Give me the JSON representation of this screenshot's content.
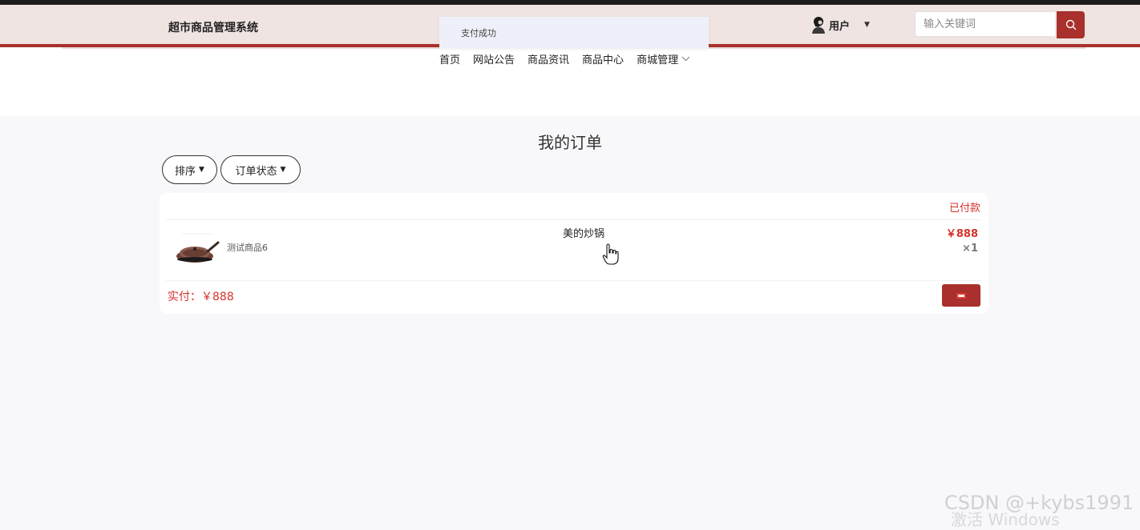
{
  "header": {
    "brand": "超市商品管理系统",
    "user_label": "用户",
    "search": {
      "placeholder": "输入关键词"
    }
  },
  "toast": {
    "message": "支付成功"
  },
  "nav": {
    "items": [
      "首页",
      "网站公告",
      "商品资讯",
      "商品中心"
    ],
    "dropdown_label": "商城管理"
  },
  "page": {
    "title": "我的订单"
  },
  "filters": {
    "sort": "排序",
    "status": "订单状态"
  },
  "order": {
    "status": "已付款",
    "product_name": "测试商品6",
    "product_title": "美的炒锅",
    "price": "￥888",
    "quantity": "×1",
    "paid_label": "实付：",
    "paid_amount": "￥888"
  },
  "watermark": {
    "csdn": "CSDN @+kybs1991",
    "windows": "激活 Windows"
  },
  "colors": {
    "accent": "#a9302c",
    "status_red": "#d6322d",
    "header_bg": "#efe4e2"
  },
  "icons": {
    "avatar": "avatar-icon",
    "search": "search-icon",
    "caret": "caret-down-icon",
    "chevron": "chevron-down-icon",
    "delete": "minus-icon",
    "cursor": "hand-pointer-icon"
  }
}
